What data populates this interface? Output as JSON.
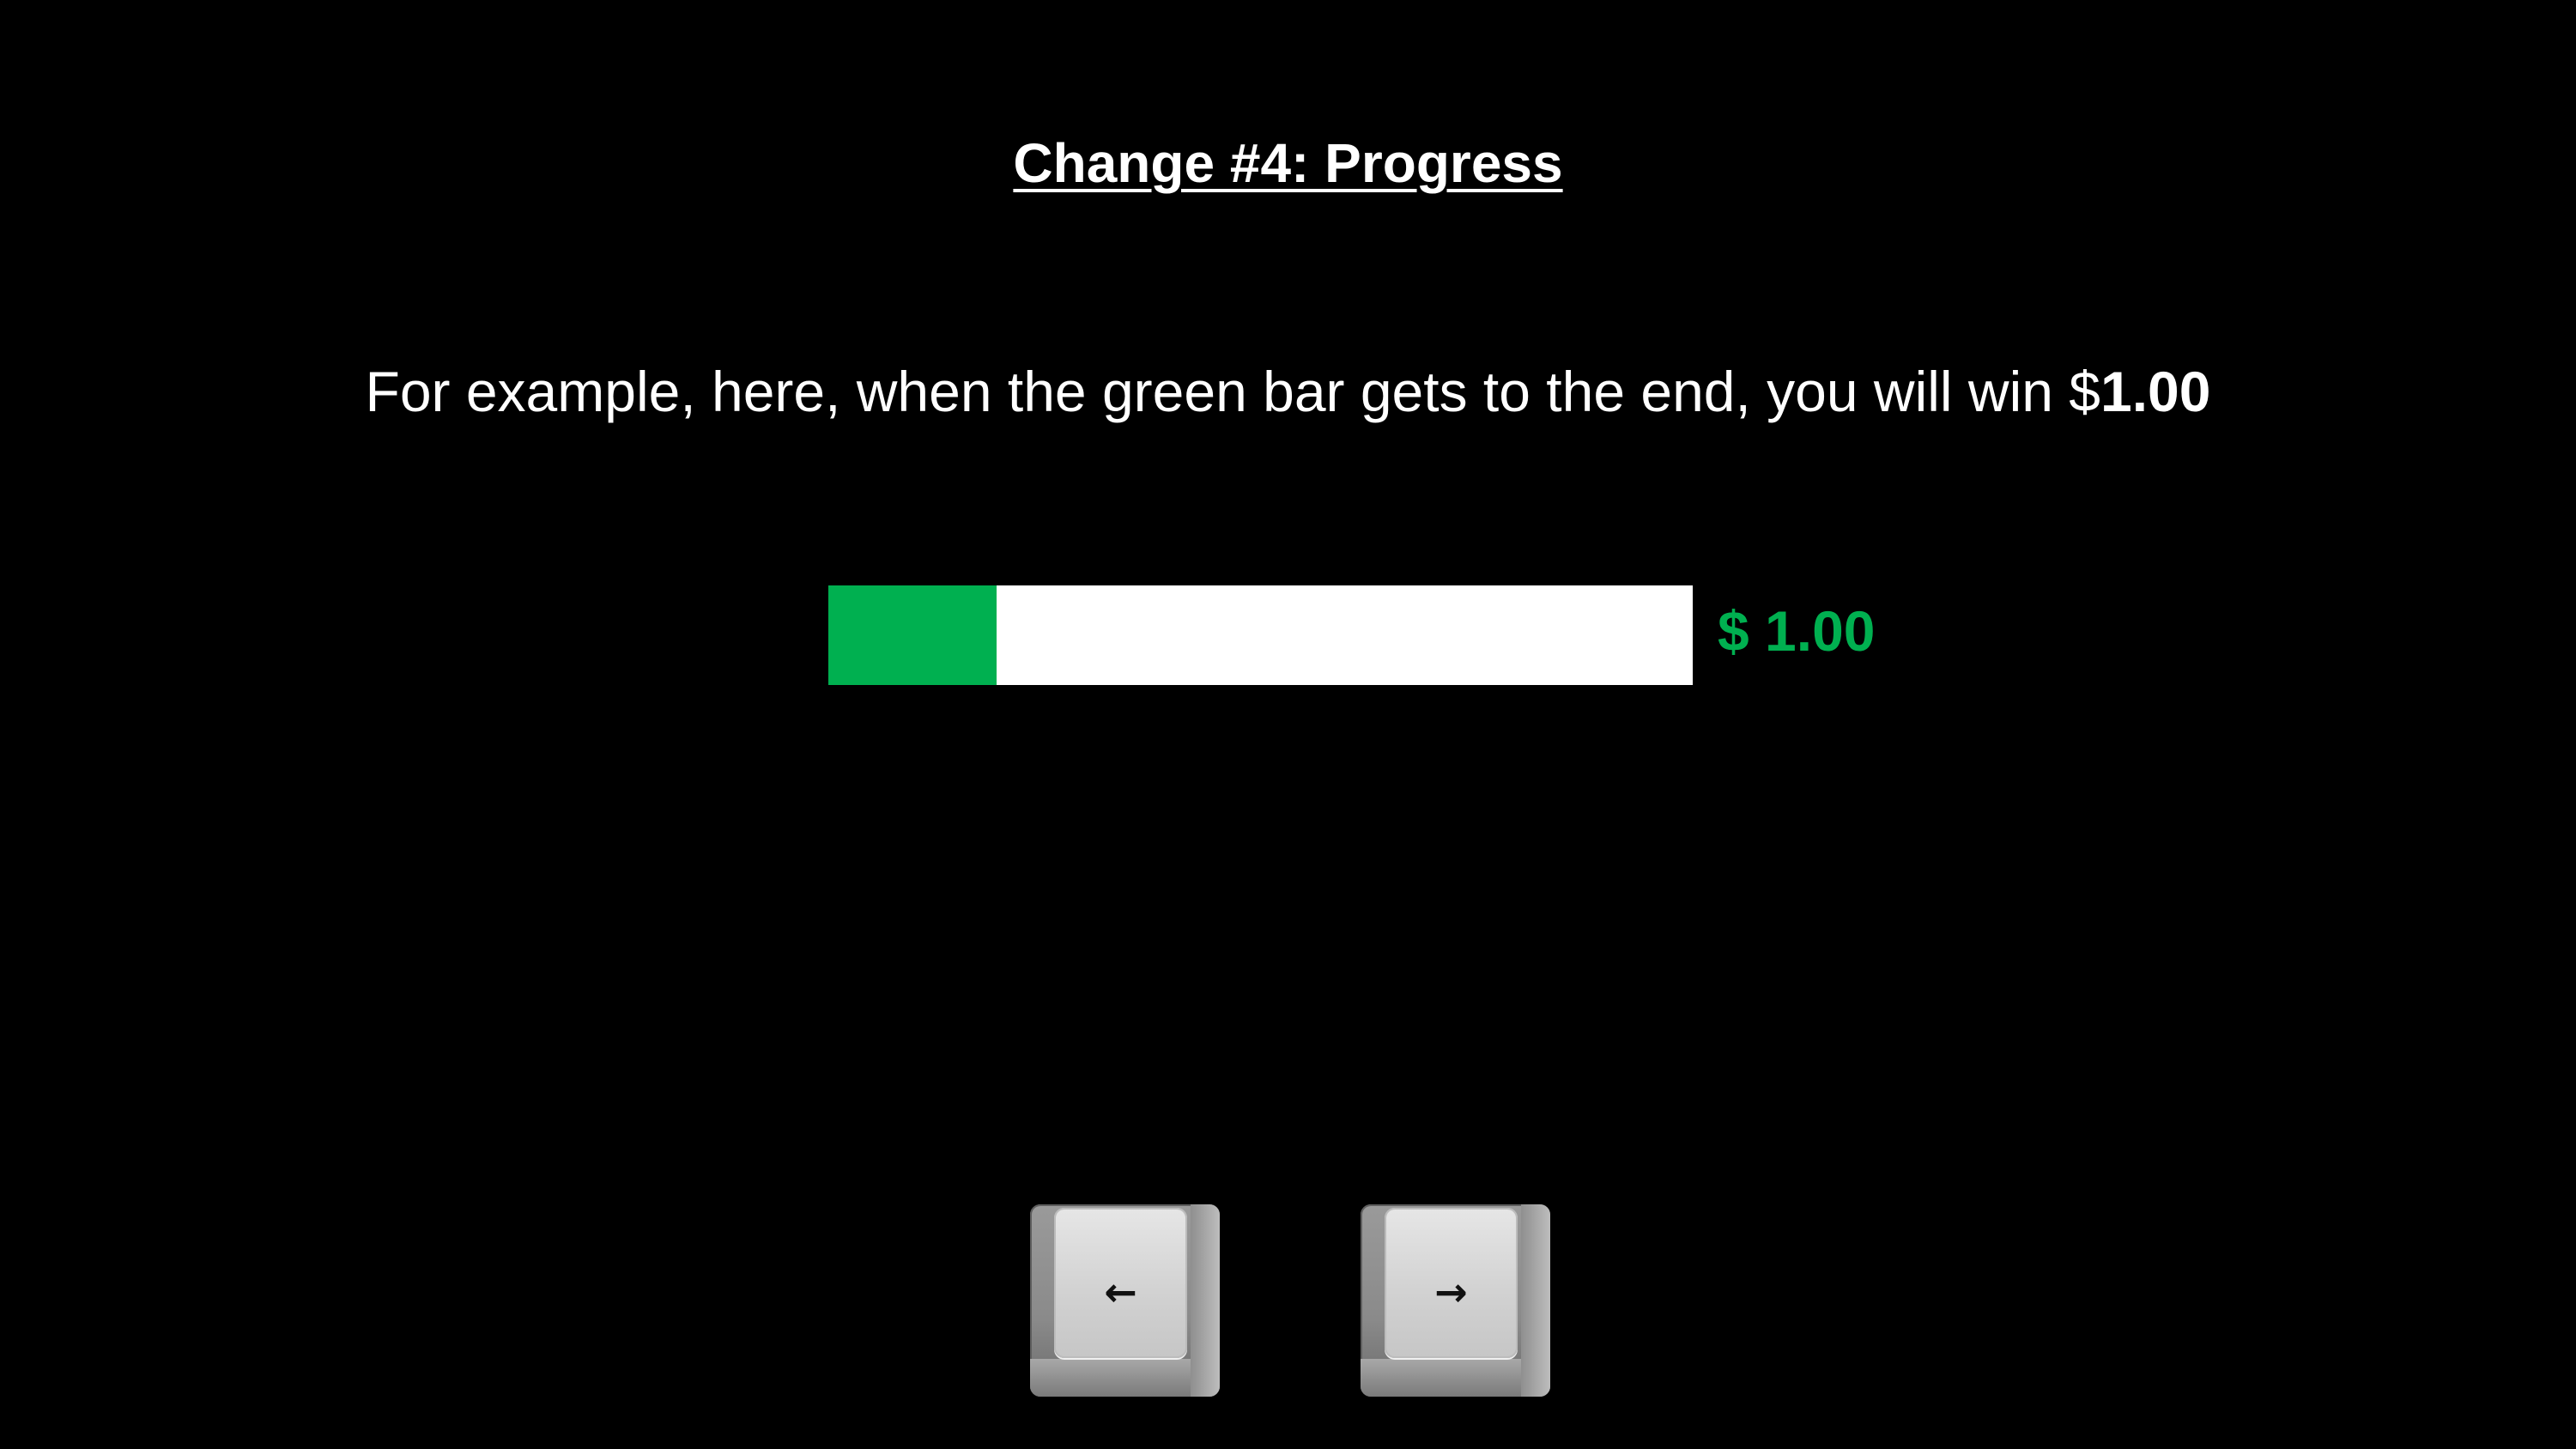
{
  "slide": {
    "title": "Change #4: Progress",
    "instruction_prefix": "For example, here, when the green bar gets to the end, you will win $",
    "instruction_amount": "1.00"
  },
  "progress_bar": {
    "fill_fraction": 0.195,
    "fill_color": "#00b050",
    "track_color": "#ffffff",
    "prize_label": "$ 1.00",
    "prize_color": "#00b050"
  },
  "keys": [
    {
      "icon": "left-arrow-key-icon",
      "glyph": "←"
    },
    {
      "icon": "right-arrow-key-icon",
      "glyph": "→"
    }
  ],
  "colors": {
    "background": "#000000",
    "text": "#ffffff"
  }
}
